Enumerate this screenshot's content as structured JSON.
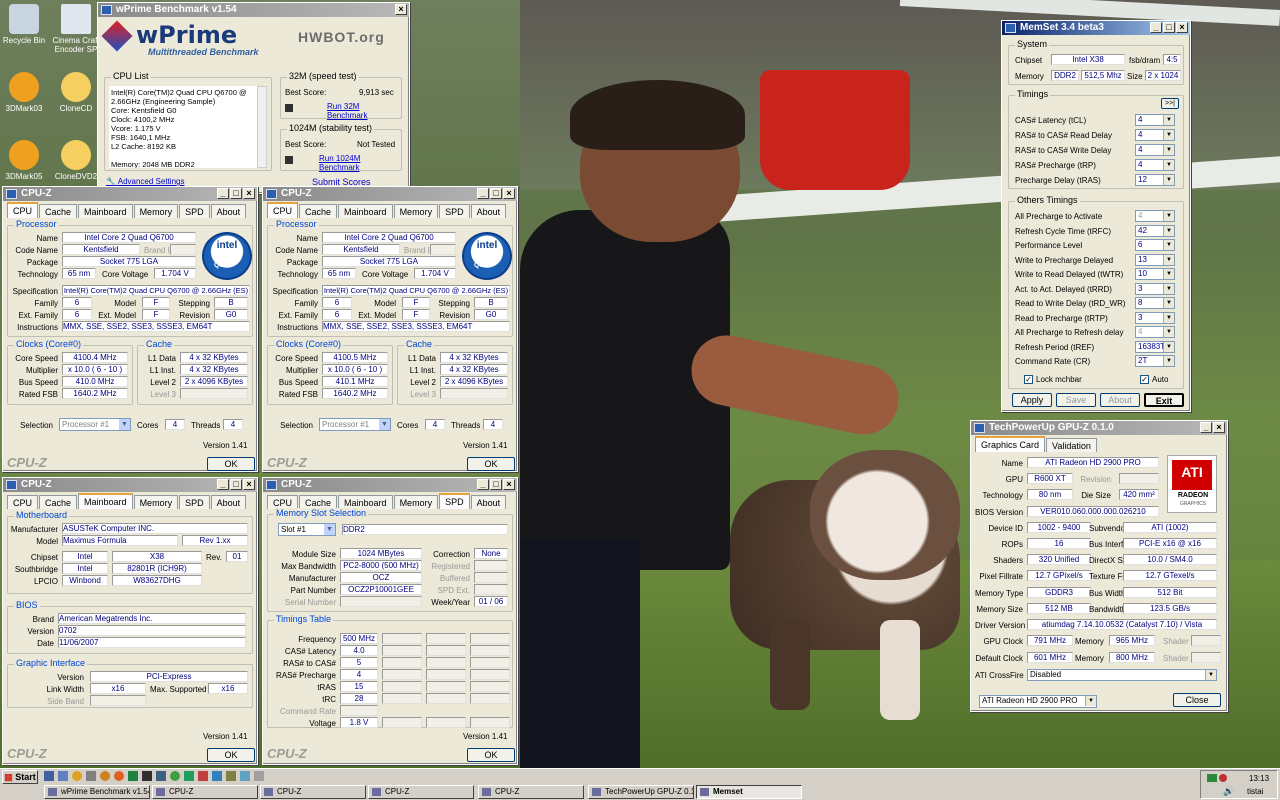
{
  "desktop": {
    "icons": [
      "Recycle Bin",
      "Cinema Craft Encoder SP",
      "3DMark03",
      "CloneCD",
      "3DMark05",
      "CloneDVD2"
    ]
  },
  "wprime": {
    "title": "wPrime Benchmark v1.54",
    "logo": "wPrime",
    "subtitle": "Multithreaded Benchmark",
    "hwbot": "HWBOT.org",
    "cpu_list_label": "CPU List",
    "cpu_list": [
      "Intel(R) Core(TM)2 Quad CPU   Q6700  @",
      "2.66GHz (Engineering Sample)",
      "Core: Kentsfield G0",
      "Clock: 4100,2 MHz",
      "Vcore: 1.175 V",
      "FSB: 1640,1 MHz",
      "L2 Cache: 8192 KB",
      "",
      "Memory: 2048 MB DDR2"
    ],
    "t32_label": "32M (speed test)",
    "best_label": "Best Score:",
    "t32_score": "9,913 sec",
    "t32_run": "Run 32M Benchmark",
    "t1024_label": "1024M (stability test)",
    "t1024_score": "Not Tested",
    "t1024_run": "Run 1024M Benchmark",
    "adv": "Advanced Settings",
    "submit": "Submit Scores"
  },
  "cpuz_common": {
    "title": "CPU-Z",
    "tabs": [
      "CPU",
      "Cache",
      "Mainboard",
      "Memory",
      "SPD",
      "About"
    ],
    "version": "Version 1.41",
    "ok": "OK",
    "brand": "CPU-Z"
  },
  "cpuz1": {
    "processor": "Processor",
    "name_l": "Name",
    "name": "Intel Core 2 Quad Q6700",
    "codename_l": "Code Name",
    "codename": "Kentsfield",
    "brandid_l": "Brand ID",
    "package_l": "Package",
    "package": "Socket 775 LGA",
    "tech_l": "Technology",
    "tech": "65 nm",
    "cv_l": "Core Voltage",
    "cv": "1.704 V",
    "spec_l": "Specification",
    "spec": "Intel(R) Core(TM)2 Quad CPU   Q6700  @ 2.66GHz (ES)",
    "family_l": "Family",
    "family": "6",
    "model_l": "Model",
    "model": "F",
    "stepping_l": "Stepping",
    "stepping": "B",
    "extfam_l": "Ext. Family",
    "extfam": "6",
    "extmodel_l": "Ext. Model",
    "extmodel": "F",
    "rev_l": "Revision",
    "rev": "G0",
    "instr_l": "Instructions",
    "instr": "MMX, SSE, SSE2, SSE3, SSSE3, EM64T",
    "clocks": "Clocks (Core#0)",
    "cache": "Cache",
    "cs_l": "Core Speed",
    "cs": "4100.4 MHz",
    "mult_l": "Multiplier",
    "mult": "x 10.0 ( 6 - 10 )",
    "bus_l": "Bus Speed",
    "bus": "410.0 MHz",
    "fsb_l": "Rated FSB",
    "fsb": "1640.2 MHz",
    "l1d_l": "L1 Data",
    "l1d": "4 x 32 KBytes",
    "l1i_l": "L1 Inst.",
    "l1i": "4 x 32 KBytes",
    "l2_l": "Level 2",
    "l2": "2 x 4096 KBytes",
    "l3_l": "Level 3",
    "sel_l": "Selection",
    "sel": "Processor #1",
    "cores_l": "Cores",
    "cores": "4",
    "threads_l": "Threads",
    "threads": "4"
  },
  "cpuz2": {
    "cs": "4100.5 MHz",
    "bus": "410.1 MHz",
    "fsb": "1640.2 MHz",
    "spec": "Intel(R) Core(TM)2 Quad CPU   Q6700  @ 2.66GHz (ES)"
  },
  "intel": {
    "line1": "intel",
    "line2": "Core 2",
    "line3": "Quad",
    "line4": "inside"
  },
  "mb": {
    "motherboard": "Motherboard",
    "manu_l": "Manufacturer",
    "manu": "ASUSTeK Computer INC.",
    "model_l": "Model",
    "model": "Maximus Formula",
    "modelrev": "Rev 1.xx",
    "chipset_l": "Chipset",
    "chipset_v": "Intel",
    "chipset": "X38",
    "rev_l": "Rev.",
    "rev": "01",
    "south_l": "Southbridge",
    "south_v": "Intel",
    "south": "82801R (ICH9R)",
    "lpcio_l": "LPCIO",
    "lpcio_v": "Winbond",
    "lpcio": "W83627DHG",
    "bios": "BIOS",
    "brand_l": "Brand",
    "brand": "American Megatrends Inc.",
    "version_l": "Version",
    "version": "0702",
    "date_l": "Date",
    "date": "11/06/2007",
    "gi": "Graphic Interface",
    "giver_l": "Version",
    "giver": "PCI-Express",
    "lw_l": "Link Width",
    "lw": "x16",
    "ms_l": "Max. Supported",
    "ms": "x16",
    "sb_l": "Side Band"
  },
  "spd": {
    "slotsel": "Memory Slot Selection",
    "slot": "Slot #1",
    "type": "DDR2",
    "modsize_l": "Module Size",
    "modsize": "1024 MBytes",
    "maxbw_l": "Max Bandwidth",
    "maxbw": "PC2-8000 (500 MHz)",
    "manu_l": "Manufacturer",
    "manu": "OCZ",
    "pn_l": "Part Number",
    "pn": "OCZ2P10001GEE",
    "sn_l": "Serial Number",
    "corr_l": "Correction",
    "corr": "None",
    "reg_l": "Registered",
    "buf_l": "Buffered",
    "spdext_l": "SPD Ext.",
    "wy_l": "Week/Year",
    "wy": "01 / 06",
    "timings": "Timings Table",
    "freq_l": "Frequency",
    "freq": "500 MHz",
    "cas_l": "CAS# Latency",
    "cas": "4.0",
    "rcd_l": "RAS# to CAS#",
    "rcd": "5",
    "rp_l": "RAS# Precharge",
    "rp": "4",
    "tras_l": "tRAS",
    "tras": "15",
    "trc_l": "tRC",
    "trc": "28",
    "cr_l": "Command Rate",
    "volt_l": "Voltage",
    "volt": "1.8 V"
  },
  "memset": {
    "title": "MemSet 3.4 beta3",
    "system": "System",
    "chipset_l": "Chipset",
    "chipset": "Intel X38",
    "fsb_l": "fsb/dram",
    "fsb": "4:5",
    "mem_l": "Memory",
    "memtype": "DDR2",
    "memspeed": "512,5 Mhz",
    "size_l": "Size",
    "size": "2 x 1024",
    "timings": "Timings",
    "more": ">>|",
    "t": [
      {
        "l": "CAS# Latency (tCL)",
        "v": "4"
      },
      {
        "l": "RAS# to CAS# Read Delay",
        "v": "4"
      },
      {
        "l": "RAS# to CAS# Write Delay",
        "v": "4"
      },
      {
        "l": "RAS# Precharge (tRP)",
        "v": "4"
      },
      {
        "l": "Precharge Delay  (tRAS)",
        "v": "12"
      }
    ],
    "others": "Others Timings",
    "o": [
      {
        "l": "All Precharge to Activate",
        "v": "4",
        "d": true
      },
      {
        "l": "Refresh Cycle Time (tRFC)",
        "v": "42"
      },
      {
        "l": "Performance Level",
        "v": "6"
      },
      {
        "l": "Write to Precharge Delayed",
        "v": "13"
      },
      {
        "l": "Write to Read Delayed (tWTR)",
        "v": "10"
      },
      {
        "l": "Act. to Act. Delayed (tRRD)",
        "v": "3"
      },
      {
        "l": "Read to Write Delay (tRD_WR)",
        "v": "8"
      },
      {
        "l": "Read to Precharge (tRTP)",
        "v": "3"
      },
      {
        "l": "All Precharge to Refresh delay",
        "v": "4",
        "d": true
      },
      {
        "l": "Refresh Period (tREF)",
        "v": "16383T"
      },
      {
        "l": "Command Rate (CR)",
        "v": "2T"
      }
    ],
    "lock": "Lock mchbar",
    "auto": "Auto",
    "apply": "Apply",
    "save": "Save",
    "about": "About",
    "exit": "Exit"
  },
  "gpuz": {
    "title": "TechPowerUp GPU-Z 0.1.0",
    "tab1": "Graphics Card",
    "tab2": "Validation",
    "ati": "ATI",
    "radeon": "RADEON",
    "graphics": "GRAPHICS",
    "rows": [
      {
        "l": "Name",
        "v": "ATI Radeon HD 2900 PRO"
      },
      {
        "l": "GPU",
        "v": "R600 XT",
        "l2": "Revision",
        "v2": ""
      },
      {
        "l": "Technology",
        "v": "80 nm",
        "l2": "Die Size",
        "v2": "420 mm²"
      },
      {
        "l": "BIOS Version",
        "v": "VER010.060.000.000.026210"
      },
      {
        "l": "Device ID",
        "v": "1002 - 9400",
        "l2": "Subvendor",
        "v2": "ATI (1002)"
      },
      {
        "l": "ROPs",
        "v": "16",
        "l2": "Bus Interface",
        "v2": "PCI-E x16 @ x16"
      },
      {
        "l": "Shaders",
        "v": "320 Unified",
        "l2": "DirectX Support",
        "v2": "10.0 / SM4.0"
      },
      {
        "l": "Pixel Fillrate",
        "v": "12.7 GPixel/s",
        "l2": "Texture Fillrate",
        "v2": "12.7 GTexel/s"
      },
      {
        "l": "Memory Type",
        "v": "GDDR3",
        "l2": "Bus Width",
        "v2": "512 Bit"
      },
      {
        "l": "Memory Size",
        "v": "512 MB",
        "l2": "Bandwidth",
        "v2": "123.5 GB/s"
      },
      {
        "l": "Driver Version",
        "v": "atiumdag 7.14.10.0532 (Catalyst 7.10) / Vista"
      }
    ],
    "gpuclock_l": "GPU Clock",
    "gpuclock": "791 MHz",
    "memory_l": "Memory",
    "memclock": "965 MHz",
    "shader_l": "Shader",
    "defclock_l": "Default Clock",
    "defclock": "601 MHz",
    "defmem": "800 MHz",
    "cf_l": "ATI CrossFire",
    "cf": "Disabled",
    "card": "ATI Radeon HD 2900 PRO",
    "close": "Close"
  },
  "taskbar": {
    "start": "Start",
    "items": [
      "wPrime Benchmark v1.54",
      "CPU-Z",
      "CPU-Z",
      "CPU-Z",
      "CPU-Z",
      "TechPowerUp GPU-Z 0.1.0",
      "Memset"
    ],
    "time": "13:13",
    "user": "tistai"
  }
}
